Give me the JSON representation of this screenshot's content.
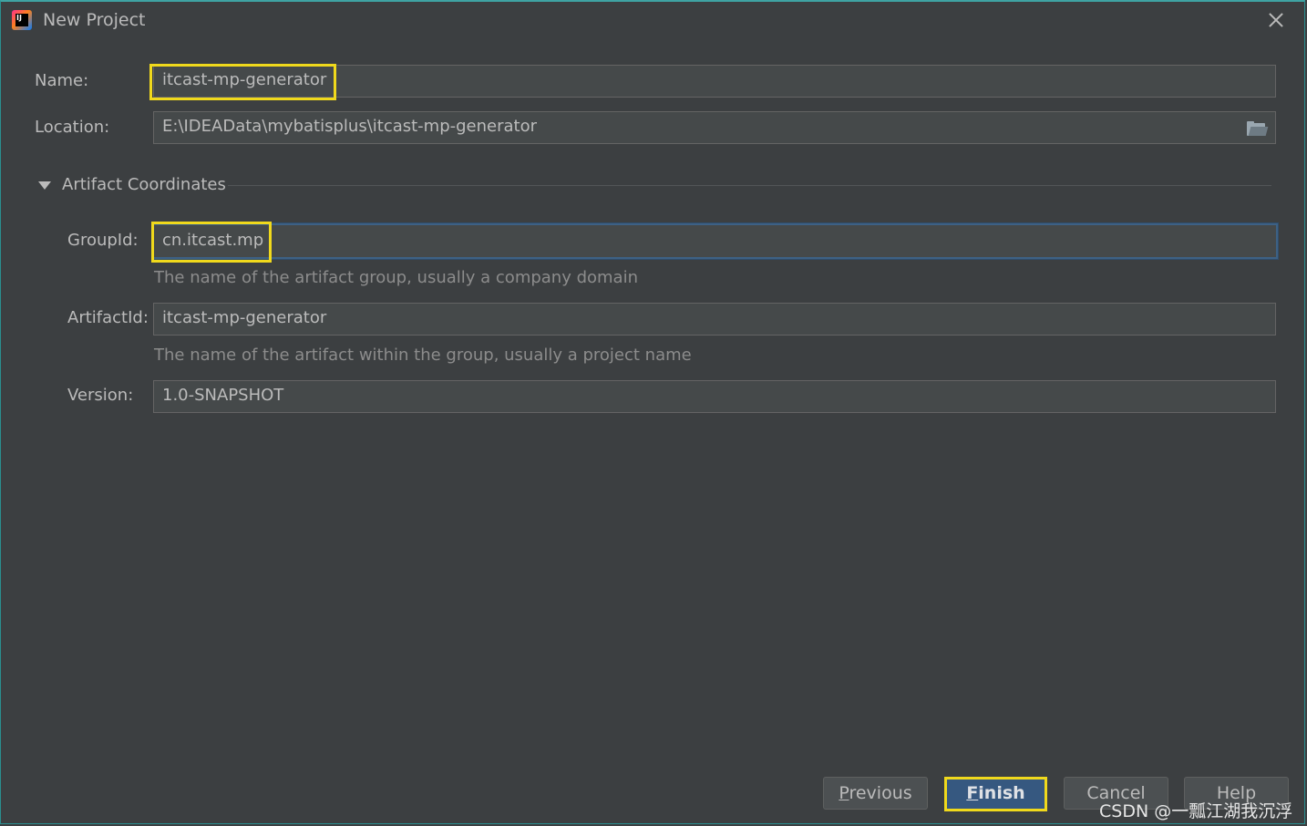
{
  "window": {
    "title": "New Project",
    "app_icon_text": "IJ"
  },
  "form": {
    "name": {
      "label": "Name:",
      "value": "itcast-mp-generator"
    },
    "location": {
      "label": "Location:",
      "value": "E:\\IDEAData\\mybatisplus\\itcast-mp-generator"
    }
  },
  "artifact": {
    "section_title": "Artifact Coordinates",
    "group_id": {
      "label": "GroupId:",
      "value": "cn.itcast.mp",
      "hint": "The name of the artifact group, usually a company domain"
    },
    "artifact_id": {
      "label": "ArtifactId:",
      "value": "itcast-mp-generator",
      "hint": "The name of the artifact within the group, usually a project name"
    },
    "version": {
      "label": "Version:",
      "value": "1.0-SNAPSHOT"
    }
  },
  "buttons": {
    "previous": {
      "mnemonic": "P",
      "rest": "revious"
    },
    "finish": {
      "mnemonic": "F",
      "rest": "inish"
    },
    "cancel": "Cancel",
    "help": "Help"
  },
  "watermark": "CSDN @一瓢江湖我沉浮",
  "colors": {
    "background": "#3c3f41",
    "field": "#45494a",
    "highlight": "#f0d91c",
    "primary_button": "#365880",
    "focus_border": "#3d6185"
  },
  "icons": {
    "folder": "folder-open-icon",
    "close": "close-icon",
    "expand": "triangle-down-icon"
  }
}
